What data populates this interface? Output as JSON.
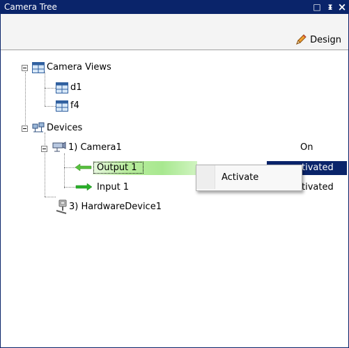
{
  "window": {
    "title": "Camera Tree",
    "btn_float": "□",
    "btn_pin": "ᵻ",
    "btn_close": "×"
  },
  "toolbar": {
    "design_label": "Design"
  },
  "tree": {
    "camera_views": {
      "label": "Camera Views",
      "children": [
        "d1",
        "f4"
      ]
    },
    "devices": {
      "label": "Devices",
      "camera": {
        "label": "1) Camera1",
        "status": "On"
      },
      "output": {
        "label": "Output 1",
        "status": "tivated"
      },
      "input": {
        "label": "Input 1",
        "status": "tivated"
      },
      "hardware": {
        "label": "3) HardwareDevice1"
      }
    }
  },
  "context_menu": {
    "activate_label": "Activate"
  },
  "colors": {
    "titlebar": "#0a246a",
    "selection": "#0a246a",
    "hover_green": "#b8ec9c",
    "output_arrow": "#58c040",
    "input_arrow": "#2ab02a"
  }
}
